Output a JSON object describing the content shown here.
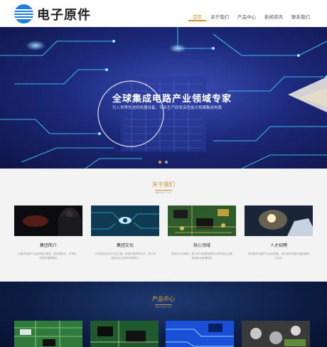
{
  "header": {
    "logo_text": "电子原件",
    "nav": [
      "首页",
      "关于我们",
      "产品中心",
      "新闻资讯",
      "联系我们"
    ]
  },
  "hero": {
    "title": "全球集成电路产业领域专家",
    "subtitle": "引入世界先进的机器设备，专业生产研发高性能大规模集成电路"
  },
  "about": {
    "title": "关于我们",
    "subtitle": "ABOUT US",
    "cards": [
      {
        "title": "集团简介",
        "desc": "从集成电路产业链的整合视角，践行国际化、市场化、创新化管理理念"
      },
      {
        "title": "集团文化",
        "desc": "公司坚持走自主开发之路，积极开展科研合作，努力提高综合实力和市场竞争力"
      },
      {
        "title": "核心领域",
        "desc": "提供全方位服务，致力成为集团和影响力的科技企业集团创新化管理理念"
      },
      {
        "title": "人才招聘",
        "desc": "推动集成电路产业优质发展，成为具有创新价值的国际化企业"
      }
    ]
  },
  "products": {
    "title": "产品中心",
    "subtitle": "PRODUCTS"
  }
}
